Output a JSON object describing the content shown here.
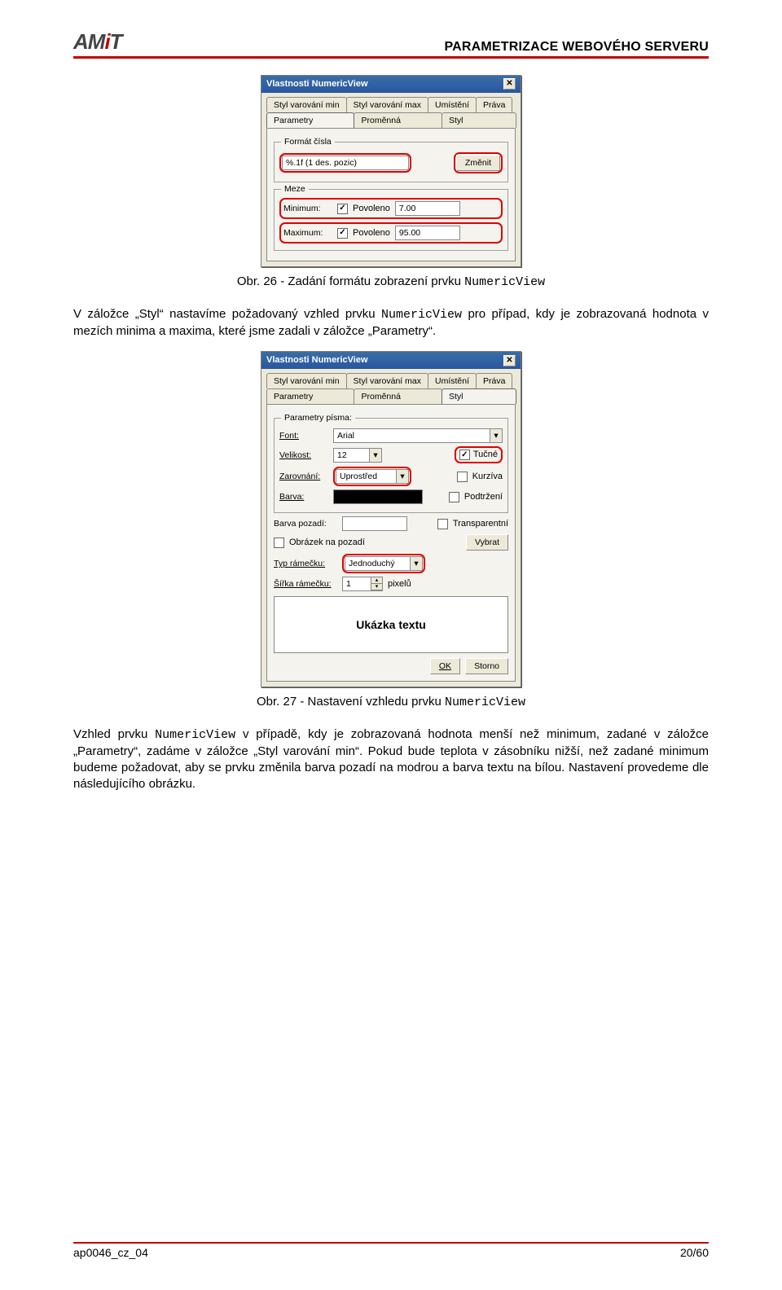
{
  "header": {
    "logo_left": "AM",
    "logo_dot": "i",
    "logo_right": "T",
    "title": "PARAMETRIZACE WEBOVÉHO SERVERU"
  },
  "dlg1": {
    "title": "Vlastnosti NumericView",
    "tabs_row1": [
      "Styl varování min",
      "Styl varování max",
      "Umístění",
      "Práva"
    ],
    "tabs_row2": [
      "Parametry",
      "Proměnná",
      "Styl"
    ],
    "active_tab": "Parametry",
    "grp_format": "Formát čísla",
    "format_value": "%.1f (1 des. pozic)",
    "change_btn": "Změnit",
    "grp_bounds": "Meze",
    "min_label": "Minimum:",
    "max_label": "Maximum:",
    "enabled": "Povoleno",
    "min_val": "7.00",
    "max_val": "95.00"
  },
  "fig1_caption_pre": "Obr. 26 - Zadání formátu zobrazení prvku ",
  "fig1_caption_code": "NumericView",
  "para1_a": "V záložce „Styl“ nastavíme požadovaný vzhled prvku ",
  "para1_code": "NumericView",
  "para1_b": " pro případ, kdy je zobrazovaná hodnota v mezích minima a maxima, které jsme zadali v záložce „Parametry“.",
  "dlg2": {
    "title": "Vlastnosti NumericView",
    "tabs_row1": [
      "Styl varování min",
      "Styl varování max",
      "Umístění",
      "Práva"
    ],
    "tabs_row2": [
      "Parametry",
      "Proměnná",
      "Styl"
    ],
    "active_tab": "Styl",
    "grp_font": "Parametry písma:",
    "font_lbl": "Font:",
    "font_val": "Arial",
    "size_lbl": "Velikost:",
    "size_val": "12",
    "bold_lbl": "Tučné",
    "align_lbl": "Zarovnání:",
    "align_val": "Uprostřed",
    "italic_lbl": "Kurzíva",
    "color_lbl": "Barva:",
    "underline_lbl": "Podtržení",
    "bgcolor_lbl": "Barva pozadí:",
    "transparent_lbl": "Transparentní",
    "bgimg_lbl": "Obrázek na pozadí",
    "choose_btn": "Vybrat",
    "border_lbl": "Typ rámečku:",
    "border_val": "Jednoduchý",
    "border_w_lbl": "Šířka rámečku:",
    "border_w_val": "1",
    "px_lbl": "pixelů",
    "preview": "Ukázka textu",
    "ok": "OK",
    "cancel": "Storno"
  },
  "fig2_caption_pre": "Obr. 27 - Nastavení vzhledu prvku ",
  "fig2_caption_code": "NumericView",
  "para2_a": "Vzhled prvku ",
  "para2_code": "NumericView",
  "para2_b": " v případě, kdy je zobrazovaná hodnota menší než minimum, zadané v záložce „Parametry“, zadáme v záložce „Styl varování min“. Pokud bude teplota v zásobníku nižší, než zadané minimum budeme požadovat, aby se prvku změnila barva pozadí na modrou a barva textu na bílou. Nastavení provedeme dle následujícího obrázku.",
  "footer": {
    "doc": "ap0046_cz_04",
    "page": "20/60"
  }
}
